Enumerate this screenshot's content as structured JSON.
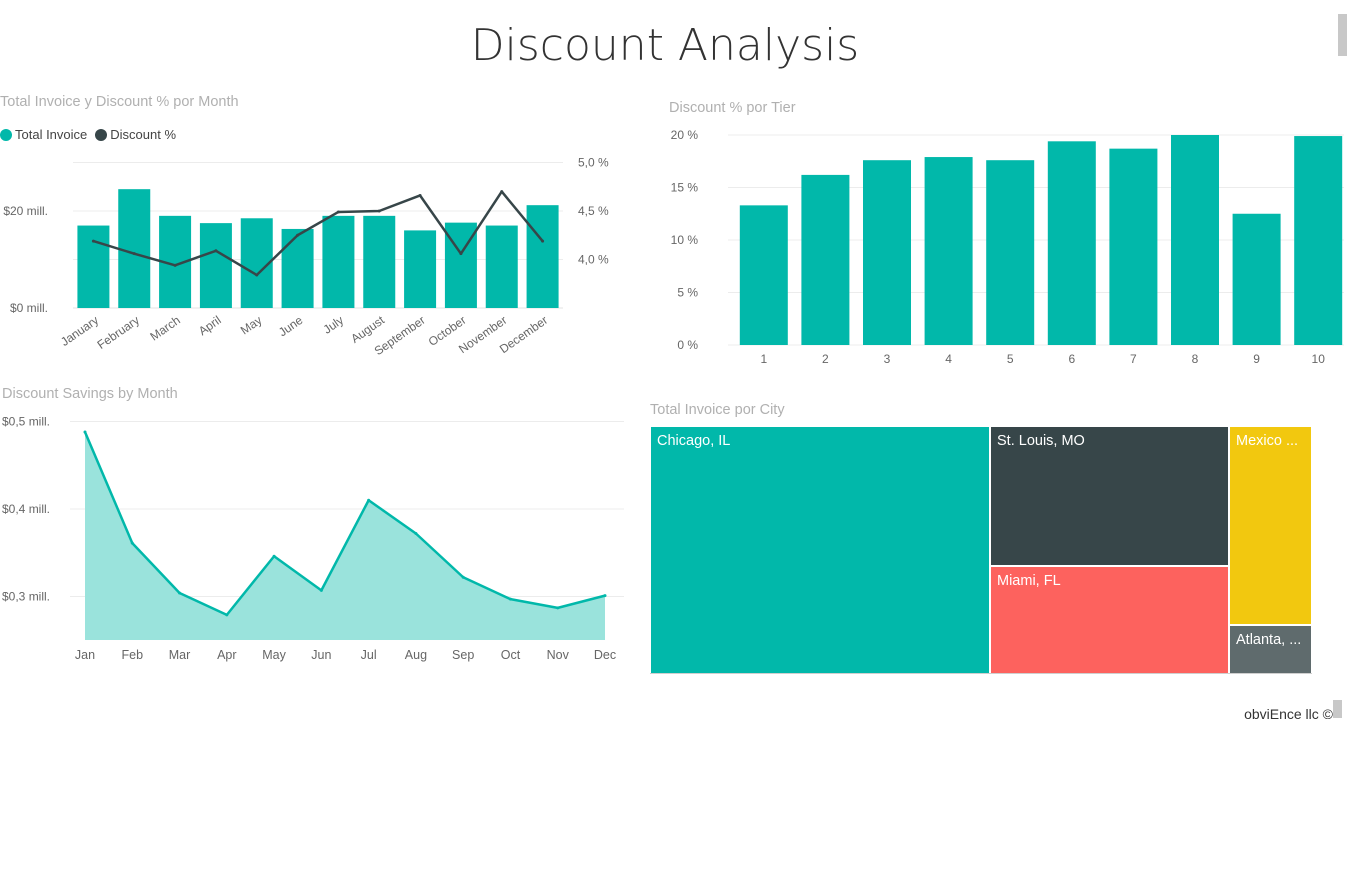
{
  "page": {
    "title": "Discount Analysis",
    "footer": "obviEnce llc ©"
  },
  "colors": {
    "teal": "#01B8AA",
    "dark": "#374649",
    "red": "#FD625E",
    "yellow": "#F2C80F",
    "gray": "#5F6B6D",
    "area_fill": "#9AE3DC"
  },
  "chart_data": [
    {
      "type": "bar",
      "title": "Total Invoice y Discount % por Month",
      "categories": [
        "January",
        "February",
        "March",
        "April",
        "May",
        "June",
        "July",
        "August",
        "September",
        "October",
        "November",
        "December"
      ],
      "series": [
        {
          "name": "Total Invoice",
          "kind": "bar",
          "axis": "left",
          "color": "#01B8AA",
          "values": [
            17,
            24.5,
            19,
            17.5,
            18.5,
            16.3,
            19,
            19,
            16,
            17.6,
            17,
            21.2
          ]
        },
        {
          "name": "Discount %",
          "kind": "line",
          "axis": "right",
          "color": "#374649",
          "values": [
            4.19,
            4.06,
            3.94,
            4.09,
            3.84,
            4.25,
            4.49,
            4.5,
            4.66,
            4.06,
            4.7,
            4.19
          ]
        }
      ],
      "left_ticks": [
        "$0 mill.",
        "$20 mill."
      ],
      "left_tick_values": [
        0,
        20
      ],
      "right_ticks": [
        "4,0 %",
        "4,5 %",
        "5,0 %"
      ],
      "right_tick_values": [
        4.0,
        4.5,
        5.0
      ],
      "legend": [
        "Total Invoice",
        "Discount %"
      ],
      "legend_position": "top-left",
      "grid": true
    },
    {
      "type": "bar",
      "title": "Discount % por Tier",
      "categories": [
        "1",
        "2",
        "3",
        "4",
        "5",
        "6",
        "7",
        "8",
        "9",
        "10"
      ],
      "values": [
        13.3,
        16.2,
        17.6,
        17.9,
        17.6,
        19.4,
        18.7,
        20.0,
        12.5,
        19.9
      ],
      "y_ticks": [
        "0 %",
        "5 %",
        "10 %",
        "15 %",
        "20 %"
      ],
      "y_tick_values": [
        0,
        5,
        10,
        15,
        20
      ],
      "ylim": [
        0,
        20
      ],
      "grid": true
    },
    {
      "type": "area",
      "title": "Discount Savings by Month",
      "categories": [
        "Jan",
        "Feb",
        "Mar",
        "Apr",
        "May",
        "Jun",
        "Jul",
        "Aug",
        "Sep",
        "Oct",
        "Nov",
        "Dec"
      ],
      "values": [
        0.488,
        0.361,
        0.304,
        0.279,
        0.346,
        0.307,
        0.41,
        0.372,
        0.322,
        0.297,
        0.287,
        0.301
      ],
      "y_ticks": [
        "$0,3 mill.",
        "$0,4 mill.",
        "$0,5 mill."
      ],
      "y_tick_values": [
        0.3,
        0.4,
        0.5
      ],
      "grid": true
    },
    {
      "type": "treemap",
      "title": "Total Invoice por City",
      "items": [
        {
          "label": "Chicago, IL",
          "color": "#01B8AA"
        },
        {
          "label": "St. Louis, MO",
          "color": "#374649"
        },
        {
          "label": "Miami, FL",
          "color": "#FD625E"
        },
        {
          "label": "Mexico ...",
          "color": "#F2C80F"
        },
        {
          "label": "Atlanta, ...",
          "color": "#5F6B6D"
        }
      ]
    }
  ]
}
